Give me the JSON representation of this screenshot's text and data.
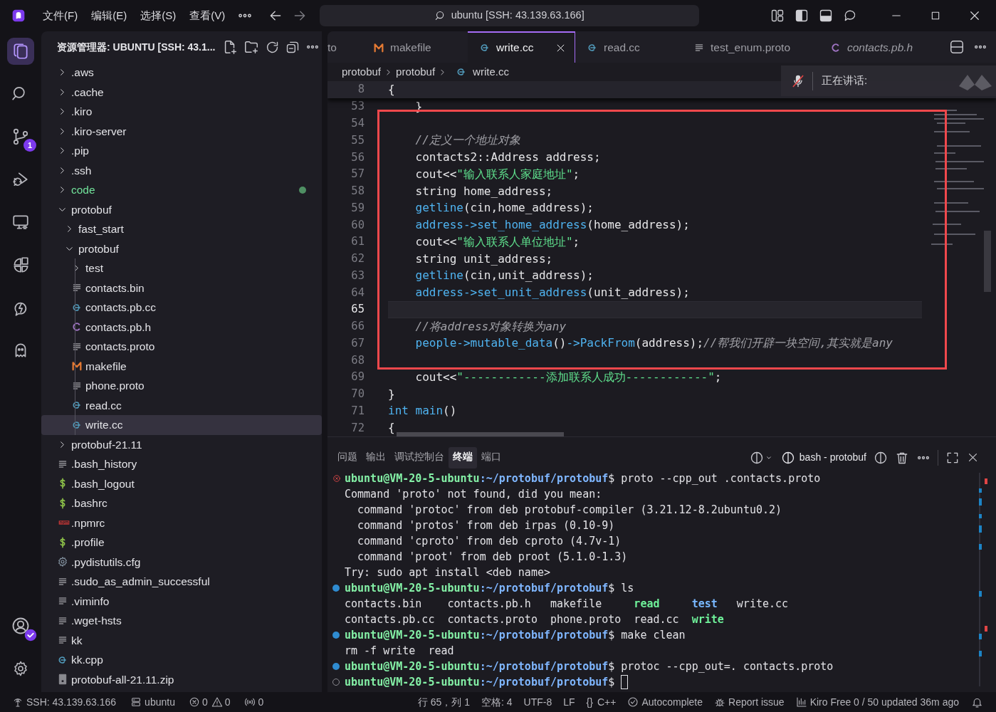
{
  "title_bar": {
    "menus": [
      "文件(F)",
      "编辑(E)",
      "选择(S)",
      "查看(V)"
    ],
    "search": "ubuntu [SSH: 43.139.63.166]"
  },
  "activity_bar": [
    {
      "kind": "explorer",
      "selected": true
    },
    {
      "kind": "search",
      "selected": false
    },
    {
      "kind": "source-control",
      "selected": false,
      "badge": "1"
    },
    {
      "kind": "run-debug",
      "selected": false
    },
    {
      "kind": "remote",
      "selected": false
    },
    {
      "kind": "extensions",
      "selected": false
    },
    {
      "kind": "kiro",
      "selected": false
    },
    {
      "kind": "ghost",
      "selected": false
    }
  ],
  "explorer": {
    "title": "资源管理器: UBUNTU [SSH: 43.1...",
    "tree": [
      {
        "label": ".aws",
        "kind": "folder",
        "expanded": false,
        "selected": false,
        "decorated": false
      },
      {
        "label": ".cache",
        "kind": "folder",
        "expanded": false,
        "selected": false,
        "decorated": false
      },
      {
        "label": ".kiro",
        "kind": "folder",
        "expanded": false,
        "selected": false,
        "decorated": false
      },
      {
        "label": ".kiro-server",
        "kind": "folder",
        "expanded": false,
        "selected": false,
        "decorated": false
      },
      {
        "label": ".pip",
        "kind": "folder",
        "expanded": false,
        "selected": false,
        "decorated": false
      },
      {
        "label": ".ssh",
        "kind": "folder",
        "expanded": false,
        "selected": false,
        "decorated": false
      },
      {
        "label": "code",
        "kind": "folder",
        "expanded": false,
        "selected": false,
        "decorated": true
      },
      {
        "label": "protobuf",
        "kind": "folder",
        "expanded": true,
        "selected": false,
        "decorated": false,
        "children": [
          {
            "label": "fast_start",
            "kind": "folder",
            "expanded": false,
            "selected": false,
            "decorated": false
          },
          {
            "label": "protobuf",
            "kind": "folder",
            "expanded": true,
            "selected": false,
            "decorated": false,
            "children": [
              {
                "label": "test",
                "kind": "folder",
                "expanded": false,
                "selected": false,
                "decorated": false
              },
              {
                "label": "contacts.bin",
                "kind": "text",
                "selected": false,
                "decorated": false
              },
              {
                "label": "contacts.pb.cc",
                "kind": "cpp",
                "selected": false,
                "decorated": false
              },
              {
                "label": "contacts.pb.h",
                "kind": "c",
                "selected": false,
                "decorated": false
              },
              {
                "label": "contacts.proto",
                "kind": "text",
                "selected": false,
                "decorated": false
              },
              {
                "label": "makefile",
                "kind": "make",
                "selected": false,
                "decorated": false
              },
              {
                "label": "phone.proto",
                "kind": "text",
                "selected": false,
                "decorated": false
              },
              {
                "label": "read.cc",
                "kind": "cpp",
                "selected": false,
                "decorated": false
              },
              {
                "label": "write.cc",
                "kind": "cpp",
                "selected": true,
                "decorated": false
              }
            ]
          }
        ]
      },
      {
        "label": "protobuf-21.11",
        "kind": "folder",
        "expanded": false,
        "selected": false,
        "decorated": false
      },
      {
        "label": ".bash_history",
        "kind": "text",
        "selected": false,
        "decorated": false
      },
      {
        "label": ".bash_logout",
        "kind": "shell",
        "selected": false,
        "decorated": false
      },
      {
        "label": ".bashrc",
        "kind": "shell",
        "selected": false,
        "decorated": false
      },
      {
        "label": ".npmrc",
        "kind": "npm",
        "selected": false,
        "decorated": false
      },
      {
        "label": ".profile",
        "kind": "shell",
        "selected": false,
        "decorated": false
      },
      {
        "label": ".pydistutils.cfg",
        "kind": "gear",
        "selected": false,
        "decorated": false
      },
      {
        "label": ".sudo_as_admin_successful",
        "kind": "text",
        "selected": false,
        "decorated": false
      },
      {
        "label": ".viminfo",
        "kind": "text",
        "selected": false,
        "decorated": false
      },
      {
        "label": ".wget-hsts",
        "kind": "text",
        "selected": false,
        "decorated": false
      },
      {
        "label": "kk",
        "kind": "text",
        "selected": false,
        "decorated": false
      },
      {
        "label": "kk.cpp",
        "kind": "cpp",
        "selected": false,
        "decorated": false
      },
      {
        "label": "protobuf-all-21.11.zip",
        "kind": "zip",
        "selected": false,
        "decorated": false
      }
    ]
  },
  "tabs": [
    {
      "label": "to",
      "kind": "none",
      "selected": false,
      "preview": false
    },
    {
      "label": "makefile",
      "kind": "make",
      "selected": false,
      "preview": false
    },
    {
      "label": "write.cc",
      "kind": "cpp",
      "selected": true,
      "preview": false
    },
    {
      "label": "read.cc",
      "kind": "cpp",
      "selected": false,
      "preview": false
    },
    {
      "label": "test_enum.proto",
      "kind": "text",
      "selected": false,
      "preview": false
    },
    {
      "label": "contacts.pb.h",
      "kind": "c",
      "selected": false,
      "preview": true
    }
  ],
  "breadcrumb": [
    "protobuf",
    "protobuf",
    "write.cc"
  ],
  "code": [
    {
      "n": "8",
      "sticky": true,
      "current": false,
      "boxed": false,
      "tokens": [
        {
          "t": "{",
          "kind": "plain"
        }
      ]
    },
    {
      "n": "53",
      "sticky": false,
      "current": false,
      "boxed": false,
      "tokens": [
        {
          "t": "    }",
          "kind": "plain"
        }
      ]
    },
    {
      "n": "54",
      "sticky": false,
      "current": false,
      "boxed": true
    },
    {
      "n": "55",
      "sticky": false,
      "current": false,
      "boxed": true,
      "tokens": [
        {
          "t": "    //定义一个地址对象",
          "kind": "comment"
        }
      ]
    },
    {
      "n": "56",
      "sticky": false,
      "current": false,
      "boxed": true,
      "tokens": [
        {
          "t": "    contacts2::Address address;",
          "kind": "plain"
        }
      ]
    },
    {
      "n": "57",
      "sticky": false,
      "current": false,
      "boxed": true,
      "tokens": [
        {
          "t": "    cout<<",
          "kind": "plain"
        },
        {
          "t": "\"输入联系人家庭地址\"",
          "kind": "str"
        },
        {
          "t": ";",
          "kind": "plain"
        }
      ]
    },
    {
      "n": "58",
      "sticky": false,
      "current": false,
      "boxed": true,
      "tokens": [
        {
          "t": "    string home_address;",
          "kind": "plain"
        }
      ]
    },
    {
      "n": "59",
      "sticky": false,
      "current": false,
      "boxed": true,
      "tokens": [
        {
          "t": "    getline",
          "kind": "fn"
        },
        {
          "t": "(cin,home_address);",
          "kind": "plain"
        }
      ]
    },
    {
      "n": "60",
      "sticky": false,
      "current": false,
      "boxed": true,
      "tokens": [
        {
          "t": "    address->set_home_address",
          "kind": "fn"
        },
        {
          "t": "(home_address);",
          "kind": "plain"
        }
      ]
    },
    {
      "n": "61",
      "sticky": false,
      "current": false,
      "boxed": true,
      "tokens": [
        {
          "t": "    cout<<",
          "kind": "plain"
        },
        {
          "t": "\"输入联系人单位地址\"",
          "kind": "str"
        },
        {
          "t": ";",
          "kind": "plain"
        }
      ]
    },
    {
      "n": "62",
      "sticky": false,
      "current": false,
      "boxed": true,
      "tokens": [
        {
          "t": "    string unit_address;",
          "kind": "plain"
        }
      ]
    },
    {
      "n": "63",
      "sticky": false,
      "current": false,
      "boxed": true,
      "tokens": [
        {
          "t": "    getline",
          "kind": "fn"
        },
        {
          "t": "(cin,unit_address);",
          "kind": "plain"
        }
      ]
    },
    {
      "n": "64",
      "sticky": false,
      "current": false,
      "boxed": true,
      "tokens": [
        {
          "t": "    address->set_unit_address",
          "kind": "fn"
        },
        {
          "t": "(unit_address);",
          "kind": "plain"
        }
      ]
    },
    {
      "n": "65",
      "sticky": false,
      "current": true,
      "boxed": true
    },
    {
      "n": "66",
      "sticky": false,
      "current": false,
      "boxed": true,
      "tokens": [
        {
          "t": "    //将address对象转换为any",
          "kind": "comment"
        }
      ]
    },
    {
      "n": "67",
      "sticky": false,
      "current": false,
      "boxed": true,
      "tokens": [
        {
          "t": "    people->mutable_data",
          "kind": "fn"
        },
        {
          "t": "()",
          "kind": "plain"
        },
        {
          "t": "->PackFrom",
          "kind": "fn"
        },
        {
          "t": "(address);",
          "kind": "plain"
        },
        {
          "t": "//帮我们开辟一块空间,其实就是any",
          "kind": "comment"
        }
      ]
    },
    {
      "n": "68",
      "sticky": false,
      "current": false,
      "boxed": true
    },
    {
      "n": "69",
      "sticky": false,
      "current": false,
      "boxed": false,
      "tokens": [
        {
          "t": "    cout<<",
          "kind": "plain"
        },
        {
          "t": "\"------------添加联系人成功------------\"",
          "kind": "str"
        },
        {
          "t": ";",
          "kind": "plain"
        }
      ]
    },
    {
      "n": "70",
      "sticky": false,
      "current": false,
      "boxed": false,
      "tokens": [
        {
          "t": "}",
          "kind": "plain"
        }
      ]
    },
    {
      "n": "71",
      "sticky": false,
      "current": false,
      "boxed": false,
      "tokens": [
        {
          "t": "int",
          "kind": "kw"
        },
        {
          "t": "main",
          "kind": "fn"
        },
        {
          "t": "()",
          "kind": "plain"
        }
      ]
    },
    {
      "n": "72",
      "sticky": false,
      "current": false,
      "boxed": false,
      "tokens": [
        {
          "t": "{",
          "kind": "plain"
        }
      ]
    }
  ],
  "toast": {
    "text": "正在讲话:"
  },
  "panel": {
    "tabs": [
      {
        "label": "问题",
        "selected": false
      },
      {
        "label": "输出",
        "selected": false
      },
      {
        "label": "调试控制台",
        "selected": false
      },
      {
        "label": "终端",
        "selected": true
      },
      {
        "label": "端口",
        "selected": false
      }
    ],
    "terminal_name": "bash - protobuf"
  },
  "terminal": [
    {
      "kind": "prompt",
      "done": true,
      "failed": true,
      "user": "ubuntu@VM-20-5-ubuntu",
      "path": ":~/protobuf/protobuf",
      "symbol": "$",
      "command": "proto --cpp_out .contacts.proto",
      "cursor": false
    },
    {
      "kind": "output",
      "text": "Command 'proto' not found, did you mean:"
    },
    {
      "kind": "indented",
      "text": "command 'protoc' from deb protobuf-compiler (3.21.12-8.2ubuntu0.2)"
    },
    {
      "kind": "indented",
      "text": "command 'protos' from deb irpas (0.10-9)"
    },
    {
      "kind": "indented",
      "text": "command 'cproto' from deb cproto (4.7v-1)"
    },
    {
      "kind": "indented",
      "text": "command 'proot' from deb proot (5.1.0-1.3)"
    },
    {
      "kind": "output",
      "text": "Try: sudo apt install <deb name>"
    },
    {
      "kind": "prompt",
      "done": true,
      "failed": false,
      "user": "ubuntu@VM-20-5-ubuntu",
      "path": ":~/protobuf/protobuf",
      "symbol": "$",
      "command": "ls",
      "cursor": false
    },
    {
      "kind": "listing",
      "entries": [
        {
          "t": "contacts.bin",
          "kind": "file"
        },
        {
          "t": "contacts.pb.h",
          "kind": "file"
        },
        {
          "t": "makefile",
          "kind": "file"
        },
        {
          "t": "read",
          "kind": "exec"
        },
        {
          "t": "test",
          "kind": "dir"
        },
        {
          "t": "write.cc",
          "kind": "file"
        }
      ]
    },
    {
      "kind": "listing",
      "entries": [
        {
          "t": "contacts.pb.cc",
          "kind": "file"
        },
        {
          "t": "contacts.proto",
          "kind": "file"
        },
        {
          "t": "phone.proto",
          "kind": "file"
        },
        {
          "t": "read.cc",
          "kind": "file"
        },
        {
          "t": "write",
          "kind": "exec"
        }
      ]
    },
    {
      "kind": "prompt",
      "done": true,
      "failed": false,
      "user": "ubuntu@VM-20-5-ubuntu",
      "path": ":~/protobuf/protobuf",
      "symbol": "$",
      "command": "make clean",
      "cursor": false
    },
    {
      "kind": "output",
      "text": "rm -f write  read"
    },
    {
      "kind": "prompt",
      "done": true,
      "failed": false,
      "user": "ubuntu@VM-20-5-ubuntu",
      "path": ":~/protobuf/protobuf",
      "symbol": "$",
      "command": "protoc --cpp_out=. contacts.proto",
      "cursor": false
    },
    {
      "kind": "prompt",
      "done": false,
      "user": "ubuntu@VM-20-5-ubuntu",
      "path": ":~/protobuf/protobuf",
      "symbol": "$",
      "cursor": true
    }
  ],
  "status_bar": {
    "left": [
      {
        "kind": "remote",
        "text": "SSH: 43.139.63.166"
      },
      {
        "kind": "user",
        "text": "ubuntu"
      },
      {
        "kind": "problems",
        "errors": "0",
        "warnings": "0"
      },
      {
        "kind": "ports",
        "text": "0"
      }
    ],
    "right": [
      {
        "kind": "plain",
        "text": "行 65，列 1"
      },
      {
        "kind": "plain",
        "text": "空格: 4"
      },
      {
        "kind": "plain",
        "text": "UTF-8"
      },
      {
        "kind": "plain",
        "text": "LF"
      },
      {
        "kind": "language",
        "glyph": "{}",
        "text": "C++"
      },
      {
        "kind": "check",
        "text": "Autocomplete"
      },
      {
        "kind": "bug",
        "text": "Report issue"
      },
      {
        "kind": "chart",
        "text": "Kiro Free 0 / 50 updated 36m ago"
      },
      {
        "kind": "bell"
      }
    ]
  }
}
